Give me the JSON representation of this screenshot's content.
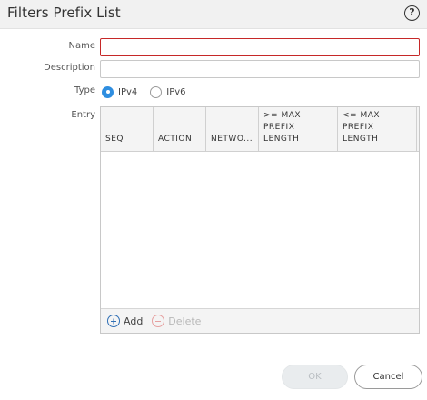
{
  "dialog": {
    "title": "Filters Prefix List",
    "help_icon": "help-circle-icon",
    "help_glyph": "?"
  },
  "form": {
    "name_label": "Name",
    "name_value": "",
    "description_label": "Description",
    "description_value": "",
    "type_label": "Type",
    "type_options": [
      {
        "label": "IPv4",
        "checked": true
      },
      {
        "label": "IPv6",
        "checked": false
      }
    ],
    "entry_label": "Entry"
  },
  "entry_table": {
    "columns": [
      "SEQ",
      "ACTION",
      "NETWO...",
      ">= MAX\nPREFIX\nLENGTH",
      "<= MAX\nPREFIX\nLENGTH"
    ],
    "rows": [],
    "add_label": "Add",
    "add_icon": "plus-circle-icon",
    "delete_label": "Delete",
    "delete_icon": "minus-circle-icon"
  },
  "footer": {
    "ok_label": "OK",
    "cancel_label": "Cancel"
  },
  "colors": {
    "accent": "#2f8ee0",
    "required_border": "#c62828",
    "add_icon": "#2f6fb5",
    "delete_icon": "#e6a0a0"
  }
}
